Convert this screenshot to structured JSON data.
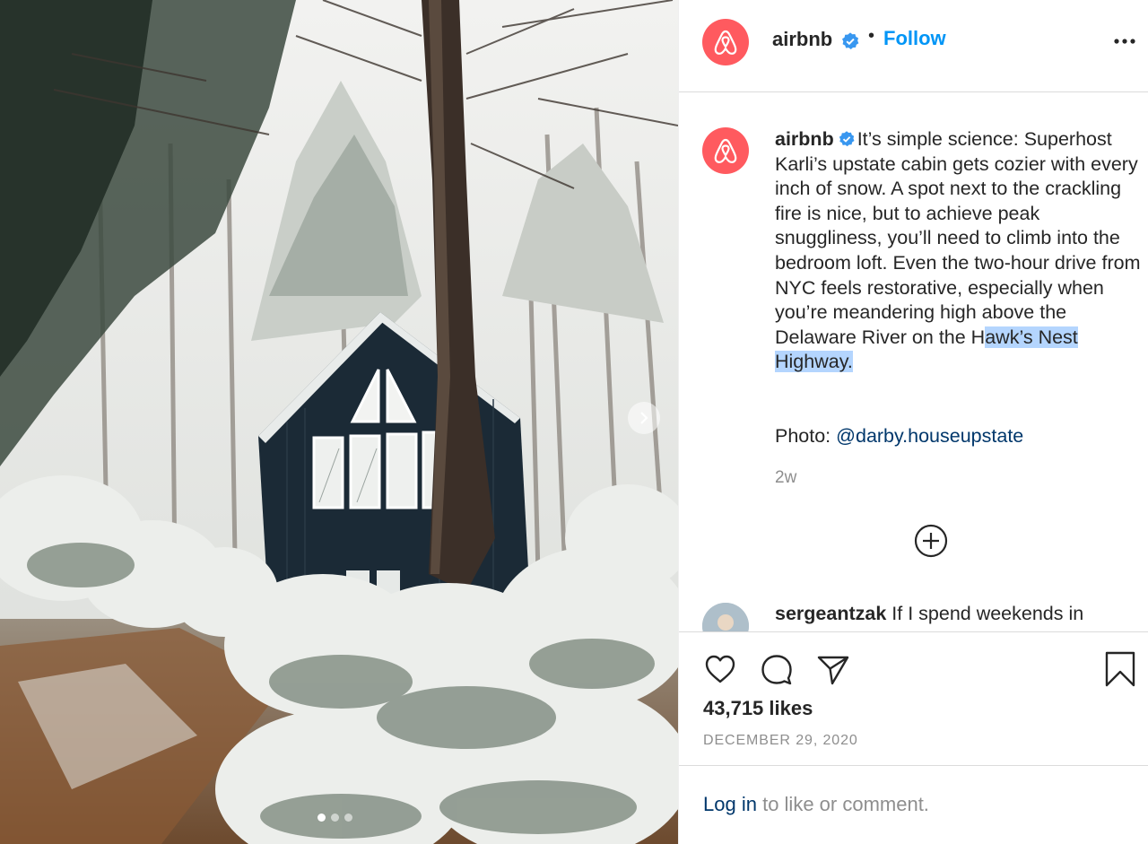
{
  "post": {
    "username": "airbnb",
    "separator": "•",
    "follow_label": "Follow",
    "more_icon": "more-options-icon",
    "caption_parts": [
      "It’s simple science: Superhost Karli’s upstate cabin gets cozier with every inch of snow. A spot next to the crackling fire is nice, but to achieve peak snuggliness, you’ll need to climb into the bedroom loft. Even the two-hour drive from NYC feels restorative, especially when you’re meandering high above the Delaware River on the H",
      "awk’s Nest Highway."
    ],
    "photo_label": "Photo:",
    "photo_mention": "@darby.houseupstate",
    "time_ago": "2w",
    "likes": "43,715 likes",
    "date": "DECEMBER 29, 2020"
  },
  "comment": {
    "username": "sergeantzak",
    "text": "If I spend weekends in"
  },
  "login": {
    "link": "Log in",
    "rest": "to like or comment."
  },
  "carousel": {
    "slides": 3,
    "active": 1
  },
  "colors": {
    "brand": "#ff5a5f",
    "follow": "#0095f6",
    "link": "#00376b",
    "muted": "#8e8e8e",
    "verified": "#3897f0",
    "selection": "#b4d5fe"
  }
}
